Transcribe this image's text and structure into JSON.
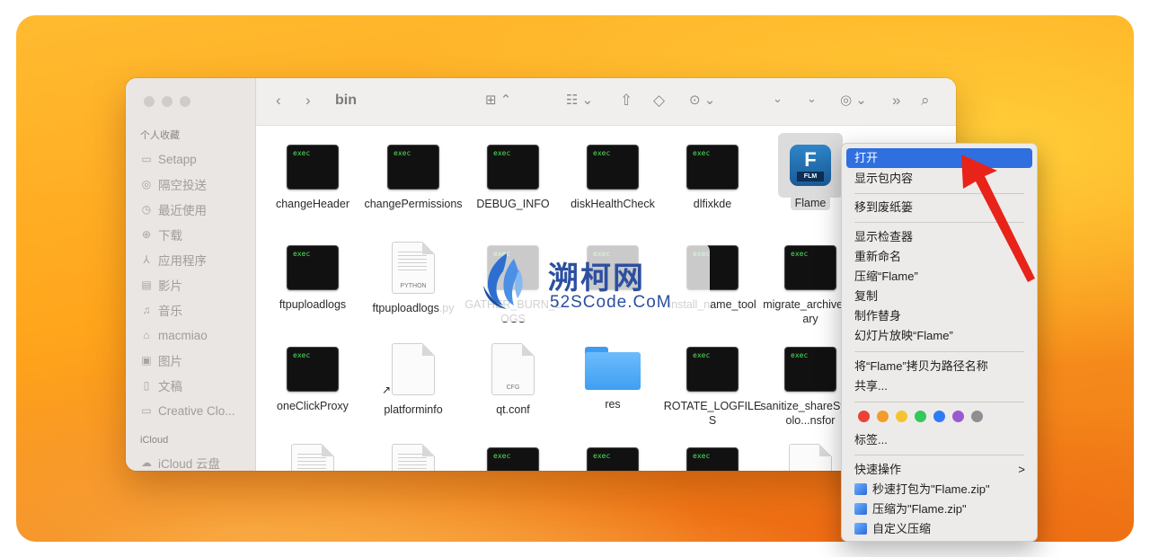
{
  "window": {
    "folder_title": "bin"
  },
  "sidebar": {
    "favorites_heading": "个人收藏",
    "items": [
      {
        "label": "Setapp",
        "icon": "folder-icon"
      },
      {
        "label": "隔空投送",
        "icon": "airdrop-icon"
      },
      {
        "label": "最近使用",
        "icon": "clock-icon"
      },
      {
        "label": "下载",
        "icon": "download-icon"
      },
      {
        "label": "应用程序",
        "icon": "apps-icon"
      },
      {
        "label": "影片",
        "icon": "film-icon"
      },
      {
        "label": "音乐",
        "icon": "music-icon"
      },
      {
        "label": "macmiao",
        "icon": "home-icon"
      },
      {
        "label": "图片",
        "icon": "photo-icon"
      },
      {
        "label": "文稿",
        "icon": "document-icon"
      },
      {
        "label": "Creative Clo...",
        "icon": "folder-icon"
      }
    ],
    "icloud_heading": "iCloud",
    "icloud_item": "iCloud 云盘"
  },
  "files": [
    {
      "name": "changeHeader",
      "kind": "exec"
    },
    {
      "name": "changePermissions",
      "kind": "exec"
    },
    {
      "name": "DEBUG_INFO",
      "kind": "exec"
    },
    {
      "name": "diskHealthCheck",
      "kind": "exec"
    },
    {
      "name": "dlfixkde",
      "kind": "exec"
    },
    {
      "name": "Flame",
      "kind": "app"
    },
    {
      "name": "ftpuploadlogs",
      "kind": "exec"
    },
    {
      "name": "ftpuploadlogs.py",
      "kind": "python",
      "tag": "PYTHON"
    },
    {
      "name": "GATHER_BURN_LOGS",
      "kind": "exec"
    },
    {
      "name": "",
      "kind": "exec"
    },
    {
      "name": "install_name_tool",
      "kind": "exec"
    },
    {
      "name": "migrate_archivelibrary",
      "kind": "exec"
    },
    {
      "name": "oneClickProxy",
      "kind": "exec"
    },
    {
      "name": "platforminfo",
      "kind": "alias"
    },
    {
      "name": "qt.conf",
      "kind": "cfg",
      "tag": "CFG"
    },
    {
      "name": "res",
      "kind": "folder"
    },
    {
      "name": "ROTATE_LOGFILES",
      "kind": "exec"
    },
    {
      "name": "sanitize_shareSynColo...nsfor",
      "kind": "exec"
    }
  ],
  "exec_label": "exec",
  "flame_badge": {
    "letter": "F",
    "text": "FLM"
  },
  "watermark": {
    "title": "溯柯网",
    "subtitle": "52SCode.CoM"
  },
  "context_menu": {
    "open": "打开",
    "show_package": "显示包内容",
    "trash": "移到废纸篓",
    "inspector": "显示检查器",
    "rename": "重新命名",
    "compress": "压缩“Flame”",
    "copy": "复制",
    "alias": "制作替身",
    "slideshow": "幻灯片放映“Flame”",
    "copy_path": "将“Flame”拷贝为路径名称",
    "share": "共享...",
    "tag_colors": [
      "#ea4335",
      "#f39c2b",
      "#f4c430",
      "#34c759",
      "#2f7bf5",
      "#9b59d0",
      "#8e8e93"
    ],
    "tags": "标签...",
    "quick_actions": "快速操作",
    "quick_actions_chevron": ">",
    "qa_items": [
      "秒速打包为\"Flame.zip\"",
      "压缩为\"Flame.zip\"",
      "自定义压缩"
    ]
  },
  "colors": {
    "accent": "#2f6fe0",
    "arrow": "#e8231a"
  }
}
